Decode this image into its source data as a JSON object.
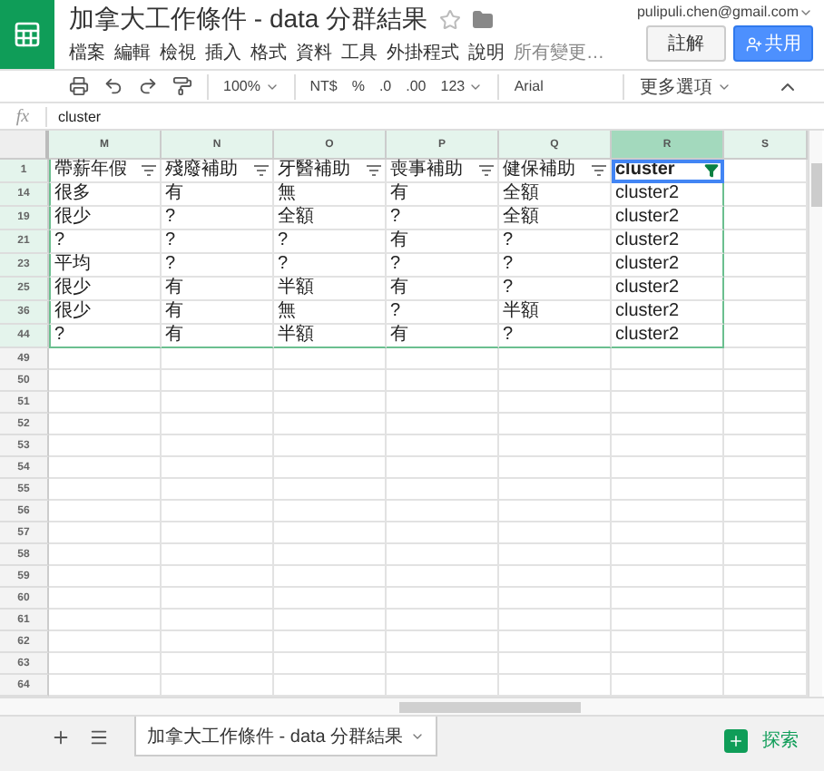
{
  "app": {
    "title": "加拿大工作條件 - data 分群結果",
    "account": "pulipuli.chen@gmail.com",
    "menu": [
      "檔案",
      "編輯",
      "檢視",
      "插入",
      "格式",
      "資料",
      "工具",
      "外掛程式",
      "說明"
    ],
    "menu_status": "所有變更…",
    "buttons": [
      {
        "label": "註解",
        "kind": "plain"
      },
      {
        "label": "共用",
        "kind": "primary"
      }
    ]
  },
  "toolbar": {
    "zoom": "100%",
    "currency": "NT$",
    "percent": "%",
    "decimal_less": ".0",
    "decimal_more": ".00",
    "format": "123",
    "font": "Arial",
    "more": "更多選項"
  },
  "formula_bar": {
    "fx": "fx",
    "value": "cluster"
  },
  "sheet": {
    "columns": [
      {
        "label": "M",
        "selected": false
      },
      {
        "label": "N",
        "selected": false
      },
      {
        "label": "O",
        "selected": false
      },
      {
        "label": "P",
        "selected": false
      },
      {
        "label": "Q",
        "selected": false
      },
      {
        "label": "R",
        "selected": true
      },
      {
        "label": "S",
        "selected": false
      }
    ],
    "header_row": {
      "number": "1",
      "cells": [
        {
          "text": "帶薪年假",
          "filtered": false
        },
        {
          "text": "殘廢補助",
          "filtered": false
        },
        {
          "text": "牙醫補助",
          "filtered": false
        },
        {
          "text": "喪事補助",
          "filtered": false
        },
        {
          "text": "健保補助",
          "filtered": false
        },
        {
          "text": "cluster",
          "filtered": true
        }
      ]
    },
    "rows": [
      {
        "number": "14",
        "cells": [
          "很多",
          "有",
          "無",
          "有",
          "全額",
          "cluster2"
        ]
      },
      {
        "number": "19",
        "cells": [
          "很少",
          "?",
          "全額",
          "?",
          "全額",
          "cluster2"
        ]
      },
      {
        "number": "21",
        "cells": [
          "?",
          "?",
          "?",
          "有",
          "?",
          "cluster2"
        ]
      },
      {
        "number": "23",
        "cells": [
          "平均",
          "?",
          "?",
          "?",
          "?",
          "cluster2"
        ]
      },
      {
        "number": "25",
        "cells": [
          "很少",
          "有",
          "半額",
          "有",
          "?",
          "cluster2"
        ]
      },
      {
        "number": "36",
        "cells": [
          "很少",
          "有",
          "無",
          "?",
          "半額",
          "cluster2"
        ]
      },
      {
        "number": "44",
        "cells": [
          "?",
          "有",
          "半額",
          "有",
          "?",
          "cluster2"
        ]
      }
    ],
    "empty_rows": [
      "49",
      "50",
      "51",
      "52",
      "53",
      "54",
      "55",
      "56",
      "57",
      "58",
      "59",
      "60",
      "61",
      "62",
      "63",
      "64"
    ]
  },
  "sheet_tabs": [
    {
      "label": "加拿大工作條件 - data 分群結果",
      "selected": true
    }
  ],
  "explore": "探索"
}
